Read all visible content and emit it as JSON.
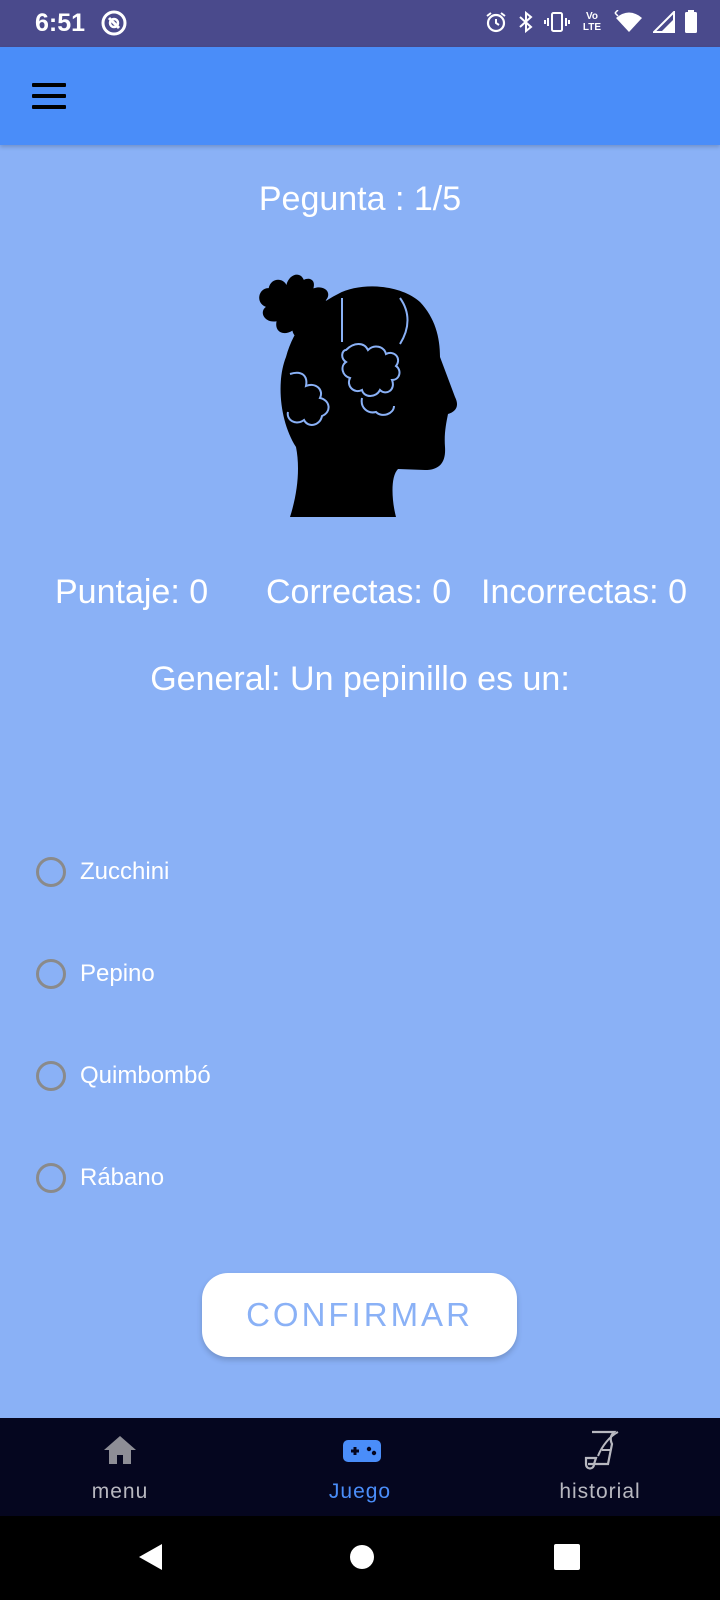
{
  "status_bar": {
    "time": "6:51",
    "network_label": "Vo LTE"
  },
  "app_bar": {
    "menu_icon": "hamburger-menu-icon"
  },
  "quiz": {
    "progress_text": "Pegunta : 1/5",
    "image": "head-puzzle-illustration",
    "score_text": "Puntaje: 0",
    "correct_text": "Correctas: 0",
    "incorrect_text": "Incorrectas: 0",
    "question_text": "General: Un pepinillo es un:",
    "options": [
      "Zucchini",
      "Pepino",
      "Quimbombó",
      "Rábano"
    ],
    "confirm_label": "CONFIRMAR"
  },
  "bottom_nav": {
    "items": [
      {
        "label": "menu",
        "icon": "home-icon",
        "active": false
      },
      {
        "label": "Juego",
        "icon": "gamepad-icon",
        "active": true
      },
      {
        "label": "historial",
        "icon": "scroll-quill-icon",
        "active": false
      }
    ]
  },
  "colors": {
    "status_bar": "#4A4A8C",
    "app_bar": "#4A8DF9",
    "background": "#8AB1F6",
    "bottom_nav": "#05061F",
    "nav_active": "#4A8DF9",
    "nav_inactive": "#B8B8C0"
  }
}
